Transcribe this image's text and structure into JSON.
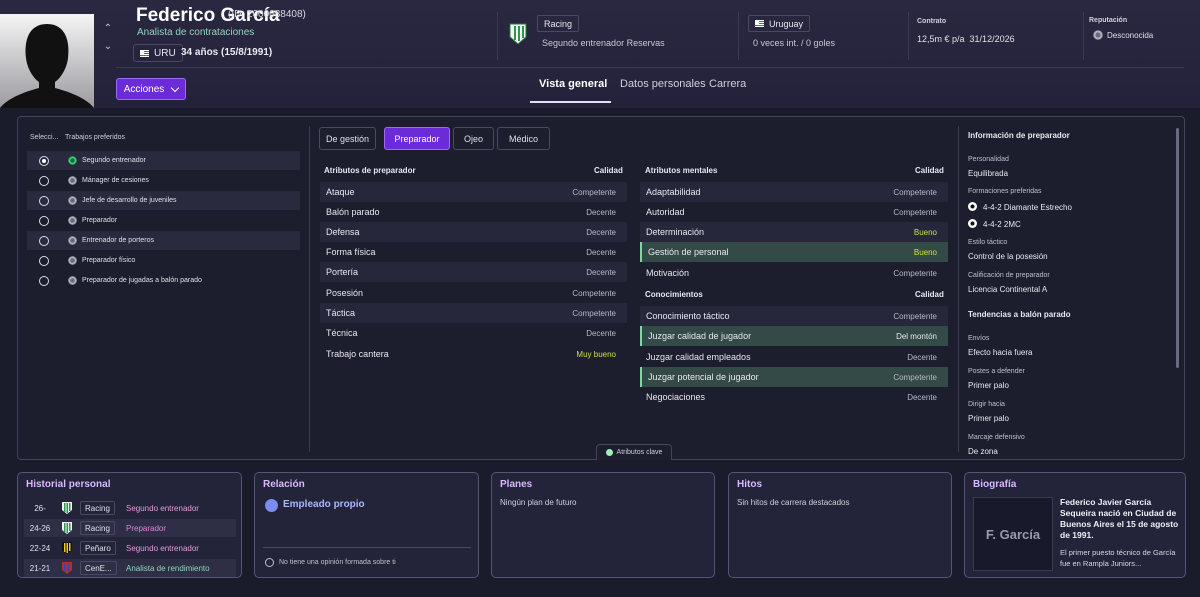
{
  "header": {
    "name": "Federico García",
    "id_text": "(ID: 2000088408)",
    "role": "Analista de contrataciones",
    "nationality_code": "URU",
    "age_text": "34 años (15/8/1991)",
    "actions_label": "Acciones",
    "club": {
      "name": "Racing",
      "role": "Segundo entrenador Reservas"
    },
    "country": {
      "name": "Uruguay",
      "caps": "0 veces int. / 0 goles"
    },
    "contract": {
      "label": "Contrato",
      "wage": "12,5m € p/a",
      "expires": "31/12/2026"
    },
    "reputation": {
      "label": "Reputación",
      "value": "Desconocida"
    },
    "tabs": [
      "Vista general",
      "Datos personales",
      "Carrera"
    ]
  },
  "jobs": {
    "col_select": "Selecci...",
    "col_jobs": "Trabajos preferidos",
    "items": [
      {
        "label": "Segundo entrenador",
        "selected": true
      },
      {
        "label": "Mánager de cesiones",
        "selected": false
      },
      {
        "label": "Jefe de desarrollo de juveniles",
        "selected": false
      },
      {
        "label": "Preparador",
        "selected": false
      },
      {
        "label": "Entrenador de porteros",
        "selected": false
      },
      {
        "label": "Preparador físico",
        "selected": false
      },
      {
        "label": "Preparador de jugadas a balón parado",
        "selected": false
      }
    ]
  },
  "subtabs": [
    "De gestión",
    "Preparador",
    "Ojeo",
    "Médico"
  ],
  "coach_attrs": {
    "title": "Atributos de preparador",
    "quality": "Calidad",
    "rows": [
      {
        "name": "Ataque",
        "value": "Competente"
      },
      {
        "name": "Balón parado",
        "value": "Decente"
      },
      {
        "name": "Defensa",
        "value": "Decente"
      },
      {
        "name": "Forma física",
        "value": "Decente"
      },
      {
        "name": "Portería",
        "value": "Decente"
      },
      {
        "name": "Posesión",
        "value": "Competente"
      },
      {
        "name": "Táctica",
        "value": "Competente"
      },
      {
        "name": "Técnica",
        "value": "Decente"
      },
      {
        "name": "Trabajo cantera",
        "value": "Muy bueno"
      }
    ]
  },
  "mental_attrs": {
    "title": "Atributos mentales",
    "quality": "Calidad",
    "rows": [
      {
        "name": "Adaptabilidad",
        "value": "Competente"
      },
      {
        "name": "Autoridad",
        "value": "Competente"
      },
      {
        "name": "Determinación",
        "value": "Bueno"
      },
      {
        "name": "Gestión de personal",
        "value": "Bueno"
      },
      {
        "name": "Motivación",
        "value": "Competente"
      }
    ]
  },
  "knowledge": {
    "title": "Conocimientos",
    "quality": "Calidad",
    "rows": [
      {
        "name": "Conocimiento táctico",
        "value": "Competente"
      },
      {
        "name": "Juzgar calidad de jugador",
        "value": "Del montón"
      },
      {
        "name": "Juzgar calidad empleados",
        "value": "Decente"
      },
      {
        "name": "Juzgar potencial de jugador",
        "value": "Competente"
      },
      {
        "name": "Negociaciones",
        "value": "Decente"
      }
    ]
  },
  "info": {
    "title": "Información de preparador",
    "personality_label": "Personalidad",
    "personality": "Equilibrada",
    "formations_label": "Formaciones preferidas",
    "formations": [
      "4-4-2 Diamante Estrecho",
      "4-4-2 2MC"
    ],
    "style_label": "Estilo táctico",
    "style": "Control de la posesión",
    "rating_label": "Calificación de preparador",
    "rating": "Licencia Continental A",
    "setpiece_title": "Tendencias a balón parado",
    "envios_label": "Envíos",
    "envios": "Efecto hacia fuera",
    "postes_label": "Postes a defender",
    "postes": "Primer palo",
    "dirigir_label": "Dirigir hacia",
    "dirigir": "Primer palo",
    "marcaje_label": "Marcaje defensivo",
    "marcaje": "De zona"
  },
  "key_attributes_label": "Atributos clave",
  "history": {
    "title": "Historial personal",
    "rows": [
      {
        "years": "26-",
        "club": "Racing",
        "role": "Segundo entrenador",
        "role_color": "#e89ae0"
      },
      {
        "years": "24-26",
        "club": "Racing",
        "role": "Preparador",
        "role_color": "#e080d8"
      },
      {
        "years": "22-24",
        "club": "Peñaro",
        "role": "Segundo entrenador",
        "role_color": "#e89ae0"
      },
      {
        "years": "21-21",
        "club": "CenE...",
        "role": "Analista de rendimiento",
        "role_color": "#8fd6b8"
      }
    ]
  },
  "relation": {
    "title": "Relación",
    "status": "Empleado propio",
    "note": "No tiene una opinión formada sobre ti"
  },
  "plans": {
    "title": "Planes",
    "text": "Ningún plan de futuro"
  },
  "milestones": {
    "title": "Hitos",
    "text": "Sin hitos de carrera destacados"
  },
  "bio": {
    "title": "Biografía",
    "image_text": "F. García",
    "lead": "Federico Javier García Sequeira nació en Ciudad de Buenos Aires el 15 de agosto de 1991.",
    "more": "El primer puesto técnico de García fue en Rampla Juniors..."
  },
  "colors": {
    "accent": "#6b2bd9",
    "good": "#c9e048",
    "highlight": "#344a46"
  }
}
